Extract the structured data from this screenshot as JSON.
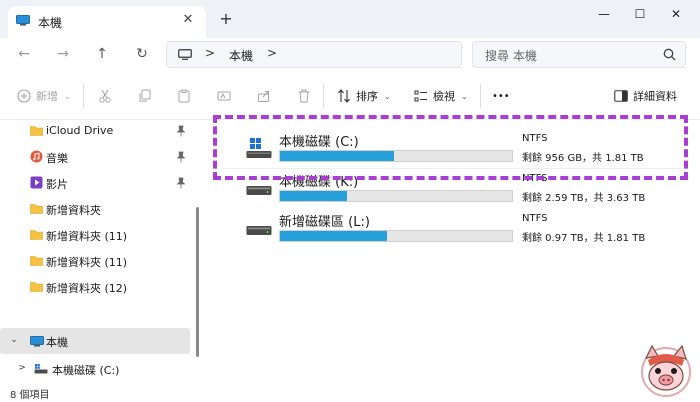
{
  "window": {
    "tab_title": "本機",
    "tab_close": "✕",
    "new_tab": "+",
    "minimize": "—",
    "maximize": "☐",
    "close": "✕"
  },
  "navigation": {
    "back": "←",
    "forward": "→",
    "up": "↑",
    "refresh": "↻",
    "separator": ">",
    "breadcrumb": "本機",
    "search_placeholder": "搜尋 本機"
  },
  "commands": {
    "new_label": "新增",
    "sort_label": "排序",
    "view_label": "檢視",
    "more": "•••",
    "details_label": "詳細資料",
    "chevron": "⌄"
  },
  "sidebar": {
    "items": [
      {
        "label": "iCloud Drive",
        "icon": "folder-icon",
        "pinned": true
      },
      {
        "label": "音樂",
        "icon": "music-icon",
        "pinned": true
      },
      {
        "label": "影片",
        "icon": "video-icon",
        "pinned": true
      },
      {
        "label": "新增資料夾",
        "icon": "folder-icon",
        "pinned": false
      },
      {
        "label": "新增資料夾 (11)",
        "icon": "folder-icon",
        "pinned": false
      },
      {
        "label": "新增資料夾 (11)",
        "icon": "folder-icon",
        "pinned": false
      },
      {
        "label": "新增資料夾 (12)",
        "icon": "folder-icon",
        "pinned": false
      }
    ],
    "this_pc": "本機",
    "this_pc_expander": "⌄",
    "local_disk": "本機磁碟 (C:)",
    "local_disk_expander": ">"
  },
  "drives": [
    {
      "name": "本機磁碟 (C:)",
      "fs": "NTFS",
      "space": "剩餘 956 GB，共 1.81 TB",
      "used_fraction": 0.49
    },
    {
      "name": "本機磁碟 (K:)",
      "fs": "NTFS",
      "space": "剩餘 2.59 TB，共 3.63 TB",
      "used_fraction": 0.29
    },
    {
      "name": "新增磁碟區 (L:)",
      "fs": "NTFS",
      "space": "剩餘 0.97 TB，共 1.81 TB",
      "used_fraction": 0.46
    }
  ],
  "status": {
    "item_count": "8 個項目"
  },
  "colors": {
    "accent": "#26a0da",
    "highlight": "#a93ed6"
  }
}
